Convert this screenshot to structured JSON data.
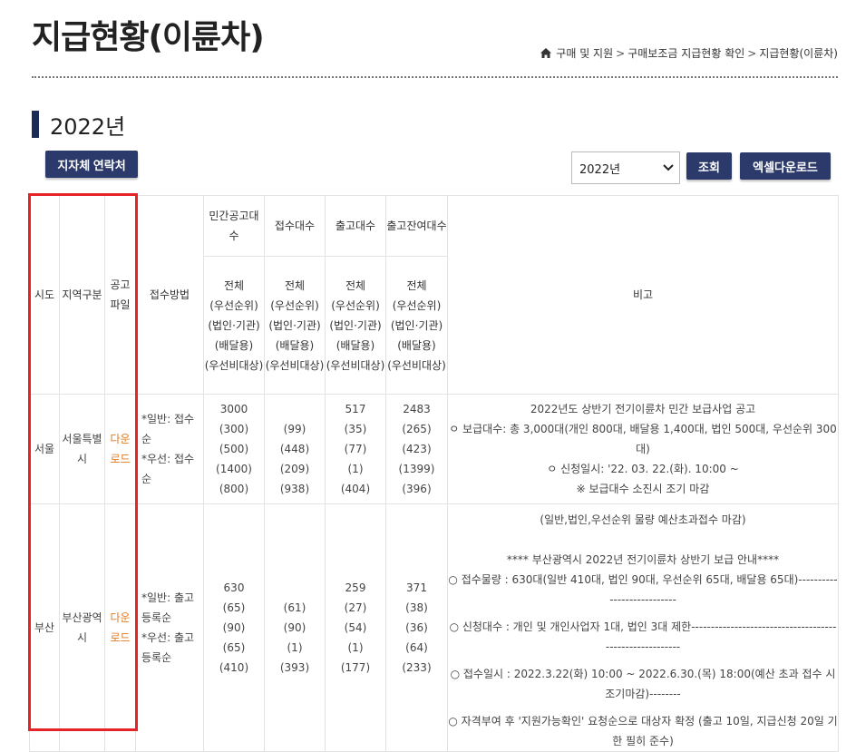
{
  "page_title": "지급현황(이륜차)",
  "breadcrumb": [
    "구매 및 지원",
    "구매보조금 지급현황 확인",
    "지급현황(이륜차)"
  ],
  "breadcrumb_icon": "home-icon",
  "section_title": "2022년",
  "buttons": {
    "contact": "지자체 연락처",
    "search": "조회",
    "excel": "엑셀다운로드"
  },
  "year_select": {
    "value": "2022년",
    "icon": "chevron-down-icon"
  },
  "table": {
    "headers": {
      "sido": "시도",
      "region": "지역구분",
      "notice_file": "공고파일",
      "method": "접수방법",
      "public": "민간공고대수",
      "received": "접수대수",
      "shipped": "출고대수",
      "remaining": "출고잔여대수",
      "note": "비고",
      "breakdown": [
        "전체",
        "(우선순위)",
        "(법인·기관)",
        "(배달용)",
        "(우선비대상)"
      ]
    },
    "rows": [
      {
        "sido": "서울",
        "region": "서울특별시",
        "file": "다운로드",
        "method": [
          "*일반: 접수순",
          "*우선: 접수순"
        ],
        "public": [
          "3000",
          "(300)",
          "(500)",
          "(1400)",
          "(800)"
        ],
        "received": [
          "",
          "(99)",
          "(448)",
          "(209)",
          "(938)"
        ],
        "shipped": [
          "517",
          "(35)",
          "(77)",
          "(1)",
          "(404)"
        ],
        "remaining": [
          "2483",
          "(265)",
          "(423)",
          "(1399)",
          "(396)"
        ],
        "note": [
          "2022년도 상반기 전기이륜차 민간 보급사업 공고",
          "ㅇ 보급대수: 총 3,000대(개인 800대, 배달용 1,400대, 법인 500대, 우선순위 300대)",
          "ㅇ 신청일시: '22. 03. 22.(화). 10:00 ~",
          "※ 보급대수 소진시 조기 마감"
        ]
      },
      {
        "sido": "부산",
        "region": "부산광역시",
        "file": "다운로드",
        "method": [
          "*일반: 출고등록순",
          "*우선: 출고등록순"
        ],
        "public": [
          "630",
          "(65)",
          "(90)",
          "(65)",
          "(410)"
        ],
        "received": [
          "",
          "(61)",
          "(90)",
          "(1)",
          "(393)"
        ],
        "shipped": [
          "259",
          "(27)",
          "(54)",
          "(1)",
          "(177)"
        ],
        "remaining": [
          "371",
          "(38)",
          "(36)",
          "(64)",
          "(233)"
        ],
        "note": [
          "(일반,법인,우선순위 물량 예산초과접수 마감)",
          "",
          "**** 부산광역시 2022년 전기이륜차 상반기 보급 안내****",
          "○ 접수물량 : 630대(일반 410대, 법인 90대, 우선순위 65대, 배달용 65대)---------------------------",
          "○ 신청대수 : 개인 및 개인사업자 1대, 법인 3대 제한--------------------------------------------------------",
          "○ 접수일시 : 2022.3.22(화) 10:00 ~ 2022.6.30.(목) 18:00(예산 초과 접수 시 조기마감)--------",
          "○ 자격부여 후 '지원가능확인' 요청순으로 대상자 확정 (출고 10일, 지급신청 20일 기한 필히 준수)"
        ]
      }
    ]
  },
  "colors": {
    "title_bar": "#1c2b54",
    "button_bg": "#2b3a6b",
    "download_link": "#e07a1f",
    "highlight_box": "#e52329"
  }
}
